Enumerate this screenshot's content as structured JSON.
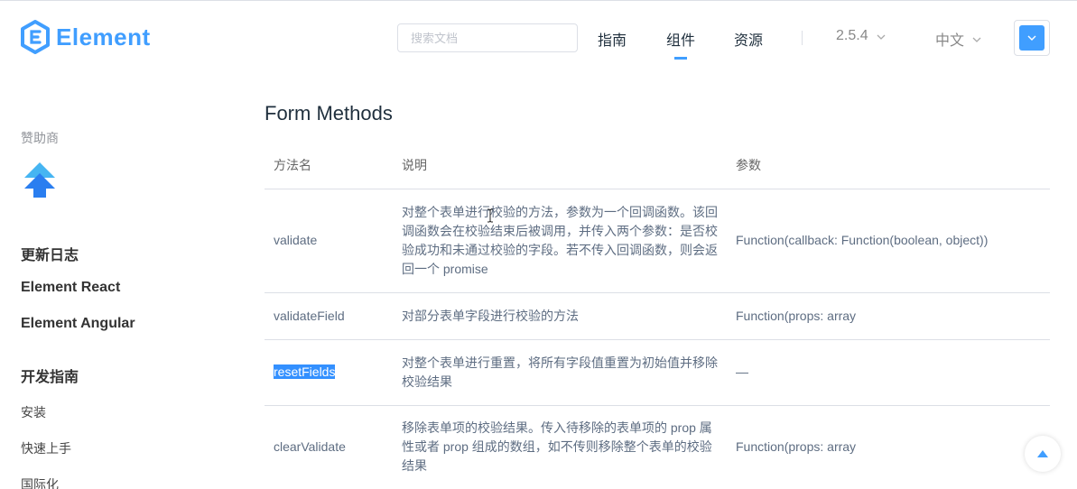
{
  "header": {
    "brand": "Element",
    "search_placeholder": "搜索文档",
    "nav": [
      "指南",
      "组件",
      "资源"
    ],
    "active_nav": "组件",
    "version": "2.5.4",
    "language": "中文",
    "accent_color": "#409EFF"
  },
  "sidebar": {
    "sponsor_label": "赞助商",
    "links": [
      "更新日志",
      "Element React",
      "Element Angular"
    ],
    "section_title": "开发指南",
    "items": [
      "安装",
      "快速上手",
      "国际化"
    ]
  },
  "main": {
    "title": "Form Methods",
    "columns": [
      "方法名",
      "说明",
      "参数"
    ],
    "rows": [
      {
        "name": "validate",
        "description": "对整个表单进行校验的方法，参数为一个回调函数。该回调函数会在校验结束后被调用，并传入两个参数：是否校验成功和未通过校验的字段。若不传入回调函数，则会返回一个 promise",
        "params": "Function(callback: Function(boolean, object))"
      },
      {
        "name": "validateField",
        "description": "对部分表单字段进行校验的方法",
        "params": "Function(props: array"
      },
      {
        "name": "resetFields",
        "description": "对整个表单进行重置，将所有字段值重置为初始值并移除校验结果",
        "params": "—"
      },
      {
        "name": "clearValidate",
        "description": "移除表单项的校验结果。传入待移除的表单项的 prop 属性或者 prop 组成的数组，如不传则移除整个表单的校验结果",
        "params": "Function(props: array"
      }
    ]
  }
}
